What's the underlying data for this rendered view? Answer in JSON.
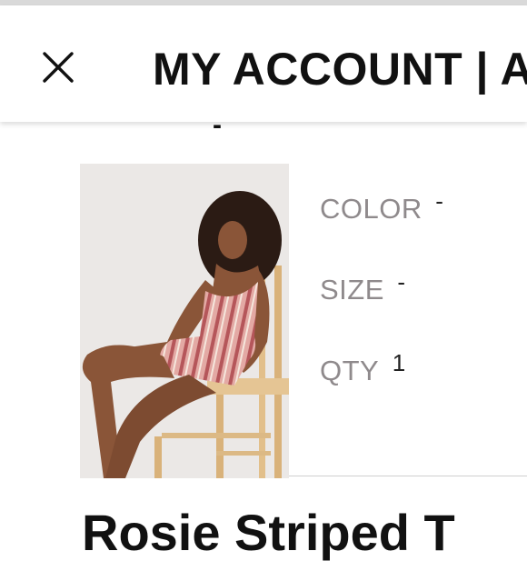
{
  "header": {
    "title": "MY ACCOUNT | A",
    "close_icon": "close-icon"
  },
  "cart_item": {
    "top_value": "-",
    "image_alt": "Woman wearing a pink striped romper sitting on a wooden chair",
    "color_label": "COLOR",
    "color_value": "-",
    "size_label": "SIZE",
    "size_value": "-",
    "qty_label": "QTY",
    "qty_value": "1",
    "product_name": "Rosie Striped T"
  },
  "colors": {
    "header_bg": "#ffffff",
    "label_gray": "#8f8a8c",
    "text_dark": "#111111",
    "divider": "#cfcfcf"
  }
}
